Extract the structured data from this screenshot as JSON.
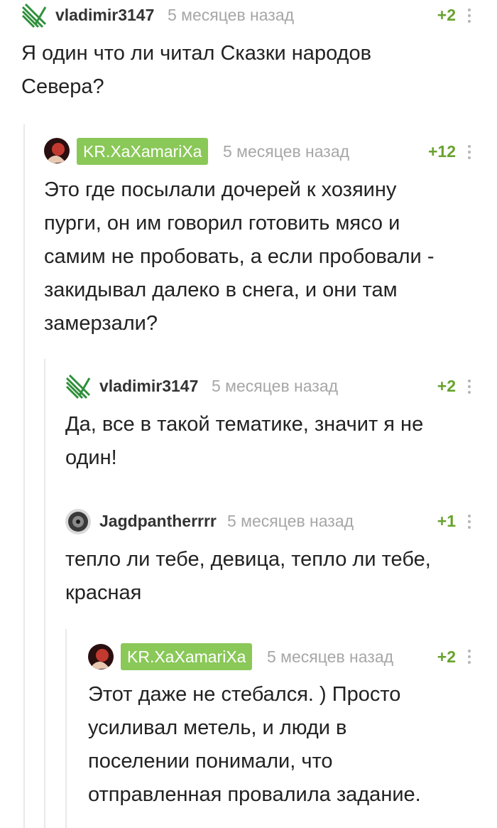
{
  "comments": [
    {
      "user": "vladimir3147",
      "time": "5 месяцев назад",
      "rating": "+2",
      "avatar_icon": "green-stripes-logo",
      "lines": [
        "Я один что ли читал Сказки народов",
        "Севера?"
      ]
    },
    {
      "user": "KR.XaXamariXa",
      "time": "5 месяцев назад",
      "rating": "+12",
      "avatar_icon": "red-portrait-avatar",
      "lines": [
        "Это где посылали дочерей к хозяину",
        "пурги, он им говорил готовить мясо и",
        "самим не пробовать, а если пробовали -",
        "закидывал далеко в снега, и они там",
        "замерзали?"
      ]
    },
    {
      "user": "vladimir3147",
      "time": "5 месяцев назад",
      "rating": "+2",
      "avatar_icon": "green-stripes-logo",
      "lines": [
        "Да, все в такой тематике, значит я не",
        "один!"
      ]
    },
    {
      "user": "Jagdpantherrrr",
      "time": "5 месяцев назад",
      "rating": "+1",
      "avatar_icon": "speaker-avatar",
      "lines": [
        "тепло ли тебе, девица, тепло ли тебе,",
        "красная"
      ]
    },
    {
      "user": "KR.XaXamariXa",
      "time": "5 месяцев назад",
      "rating": "+2",
      "avatar_icon": "red-portrait-avatar",
      "lines": [
        "Этот даже не стебался. ) Просто",
        "усиливал метель, и люди в",
        "поселении понимали, что",
        "отправленная провалила задание."
      ]
    }
  ],
  "colors": {
    "author_badge": "#8ac858",
    "rating": "#67a32d",
    "time": "#a7a7a7",
    "thread_line": "#e9e9e9"
  }
}
